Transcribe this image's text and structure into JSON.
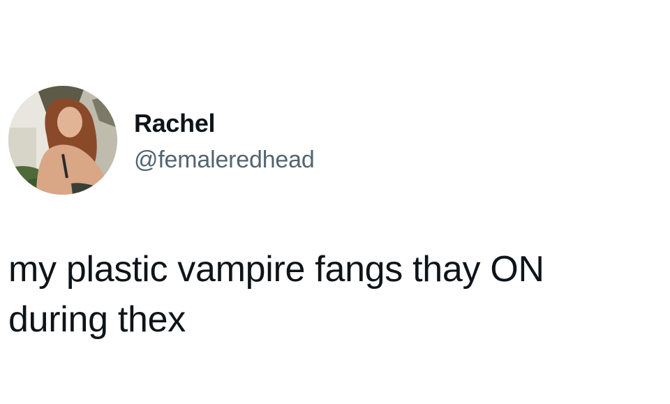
{
  "tweet": {
    "author": {
      "display_name": "Rachel",
      "handle": "@femaleredhead",
      "avatar_icon": "profile-photo"
    },
    "text_lines": [
      "my plastic vampire fangs thay ON",
      "during thex"
    ]
  },
  "colors": {
    "background": "#ffffff",
    "primary_text": "#0f1419",
    "secondary_text": "#536471"
  }
}
